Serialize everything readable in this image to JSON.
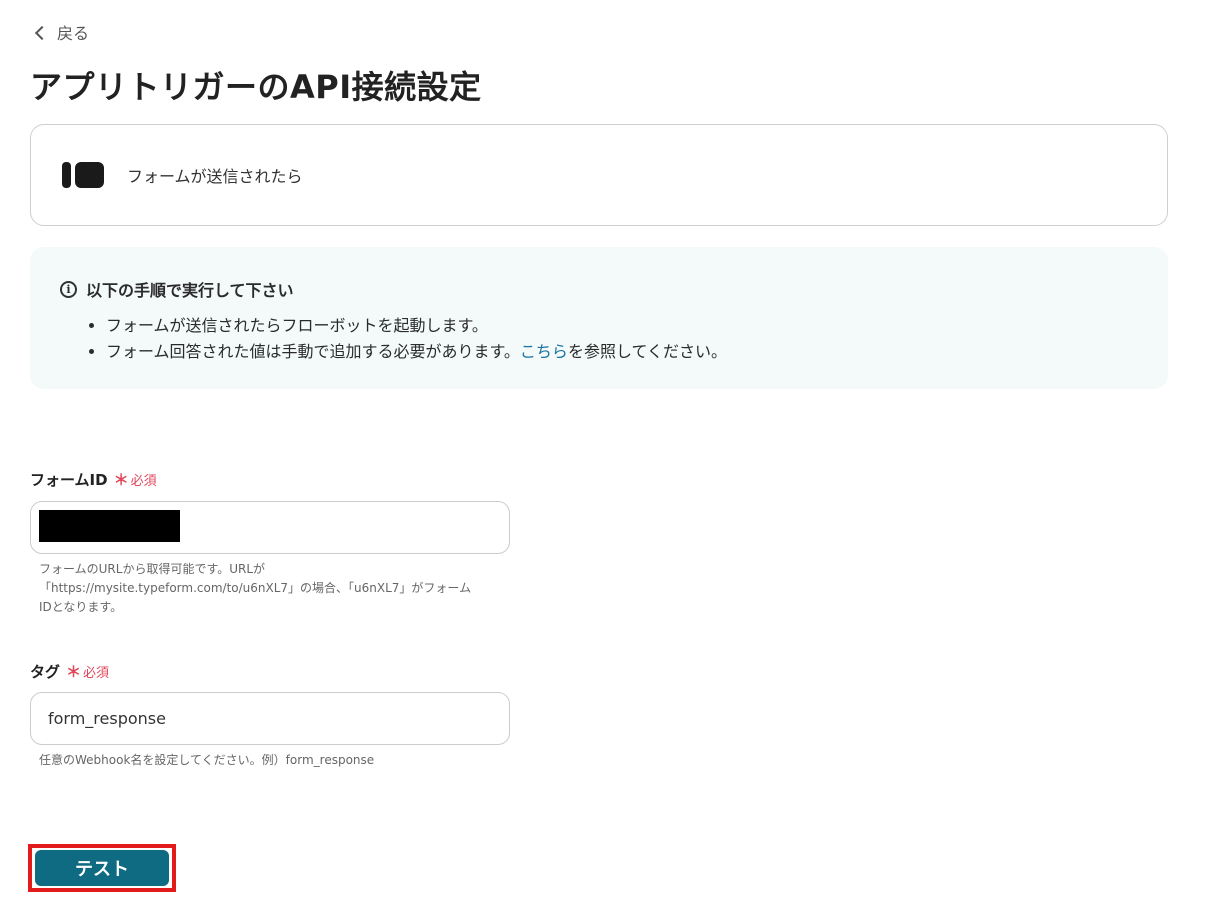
{
  "nav": {
    "back_label": "戻る"
  },
  "page": {
    "title": "アプリトリガーのAPI接続設定"
  },
  "trigger": {
    "label": "フォームが送信されたら"
  },
  "info": {
    "heading": "以下の手順で実行して下さい",
    "items": [
      "フォームが送信されたらフローボットを起動します。"
    ],
    "item2_before_link": "フォーム回答された値は手動で追加する必要があります。",
    "item2_link": "こちら",
    "item2_after_link": "を参照してください。"
  },
  "form_id": {
    "label": "フォームID",
    "required_mark": "＊",
    "required_label": "必須",
    "value": "",
    "hint_line1": "フォームのURLから取得可能です。URLが",
    "hint_line2": "「https://mysite.typeform.com/to/u6nXL7」の場合、「u6nXL7」がフォーム",
    "hint_line3": "IDとなります。"
  },
  "tag": {
    "label": "タグ",
    "required_mark": "＊",
    "required_label": "必須",
    "value": "form_response",
    "hint": "任意のWebhook名を設定してください。例）form_response"
  },
  "actions": {
    "test_label": "テスト"
  },
  "colors": {
    "accent": "#0f6b82",
    "required": "#e0475a",
    "highlight_frame": "#e21b1b",
    "info_bg": "#f3faf9",
    "link": "#1a73a0"
  }
}
